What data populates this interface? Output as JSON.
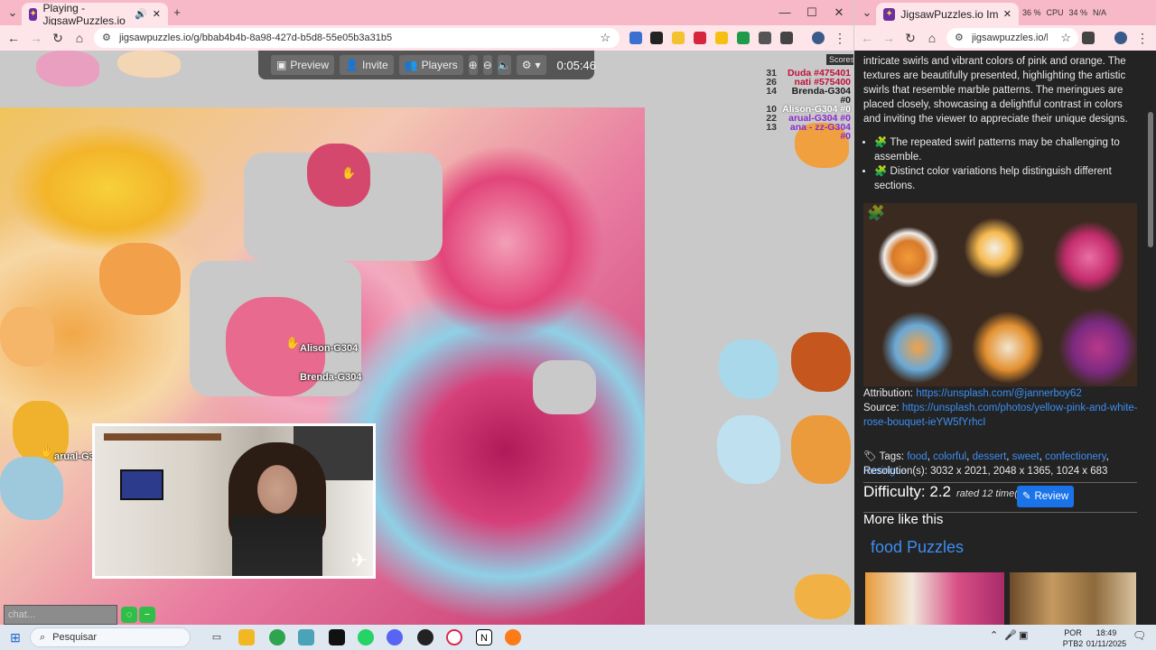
{
  "left_browser": {
    "tab_title": "Playing - JigsawPuzzles.io",
    "url": "jigsawpuzzles.io/g/bbab4b4b-8a98-427d-b5d8-55e05b3a31b5",
    "new_tab": "+",
    "win_minimize": "—",
    "win_maximize": "☐",
    "win_close": "✕"
  },
  "game_bar": {
    "preview_label": "Preview",
    "invite_label": "Invite",
    "players_label": "Players",
    "timer": "0:05:46"
  },
  "scores": {
    "label": "Scores",
    "rows": [
      {
        "score": "31",
        "name": "Duda #475401",
        "color": "#c0113a"
      },
      {
        "score": "26",
        "name": "nati #575400",
        "color": "#c0113a"
      },
      {
        "score": "14",
        "name": "Brenda-G304 #0",
        "color": "#1a1a1a"
      },
      {
        "score": "10",
        "name": "Alison-G304 #0",
        "color": "#ffffff"
      },
      {
        "score": "22",
        "name": "arual-G304 #0",
        "color": "#8a2bd0"
      },
      {
        "score": "13",
        "name": "ana - zz-G304 #0",
        "color": "#8a2bd0"
      }
    ]
  },
  "players_on_board": [
    {
      "name": "Alison-G304"
    },
    {
      "name": "Brenda-G304"
    },
    {
      "name": "arual-G3"
    }
  ],
  "chat": {
    "placeholder": "chat..."
  },
  "right_browser": {
    "tab_title": "JigsawPuzzles.io Image - Vibra",
    "url": "jigsawpuzzles.io/b...",
    "cpu_label": "CPU",
    "cpu_value": "34 %",
    "mem_value": "36 %",
    "gpu_value": "N/A"
  },
  "page": {
    "description": "intricate swirls and vibrant colors of pink and orange. The textures are beautifully presented, highlighting the artistic swirls that resemble marble patterns. The meringues are placed closely, showcasing a delightful contrast in colors and inviting the viewer to appreciate their unique designs.",
    "bullets": [
      "The repeated swirl patterns may be challenging to assemble.",
      "Distinct color variations help distinguish different sections."
    ],
    "attribution_label": "Attribution:",
    "attribution_link": "https://unsplash.com/@jannerboy62",
    "source_label": "Source:",
    "source_link": "https://unsplash.com/photos/yellow-pink-and-white-rose-bouquet-ieYW5fYrhcI",
    "tags_label": "Tags:",
    "tags": [
      "food",
      "colorful",
      "dessert",
      "sweet",
      "confectionery",
      "meringue"
    ],
    "resolutions": "Resolution(s): 3032 x 2021, 2048 x 1365, 1024 x 683",
    "difficulty": "Difficulty: 2.2",
    "rated": "rated 12 time(s)",
    "review_label": "Review",
    "more_like_this": "More like this",
    "food_puzzles": "food Puzzles"
  },
  "taskbar": {
    "search_placeholder": "Pesquisar",
    "lang_top": "POR",
    "lang_bottom": "PTB2",
    "time": "18:49",
    "date": "01/11/2025"
  }
}
